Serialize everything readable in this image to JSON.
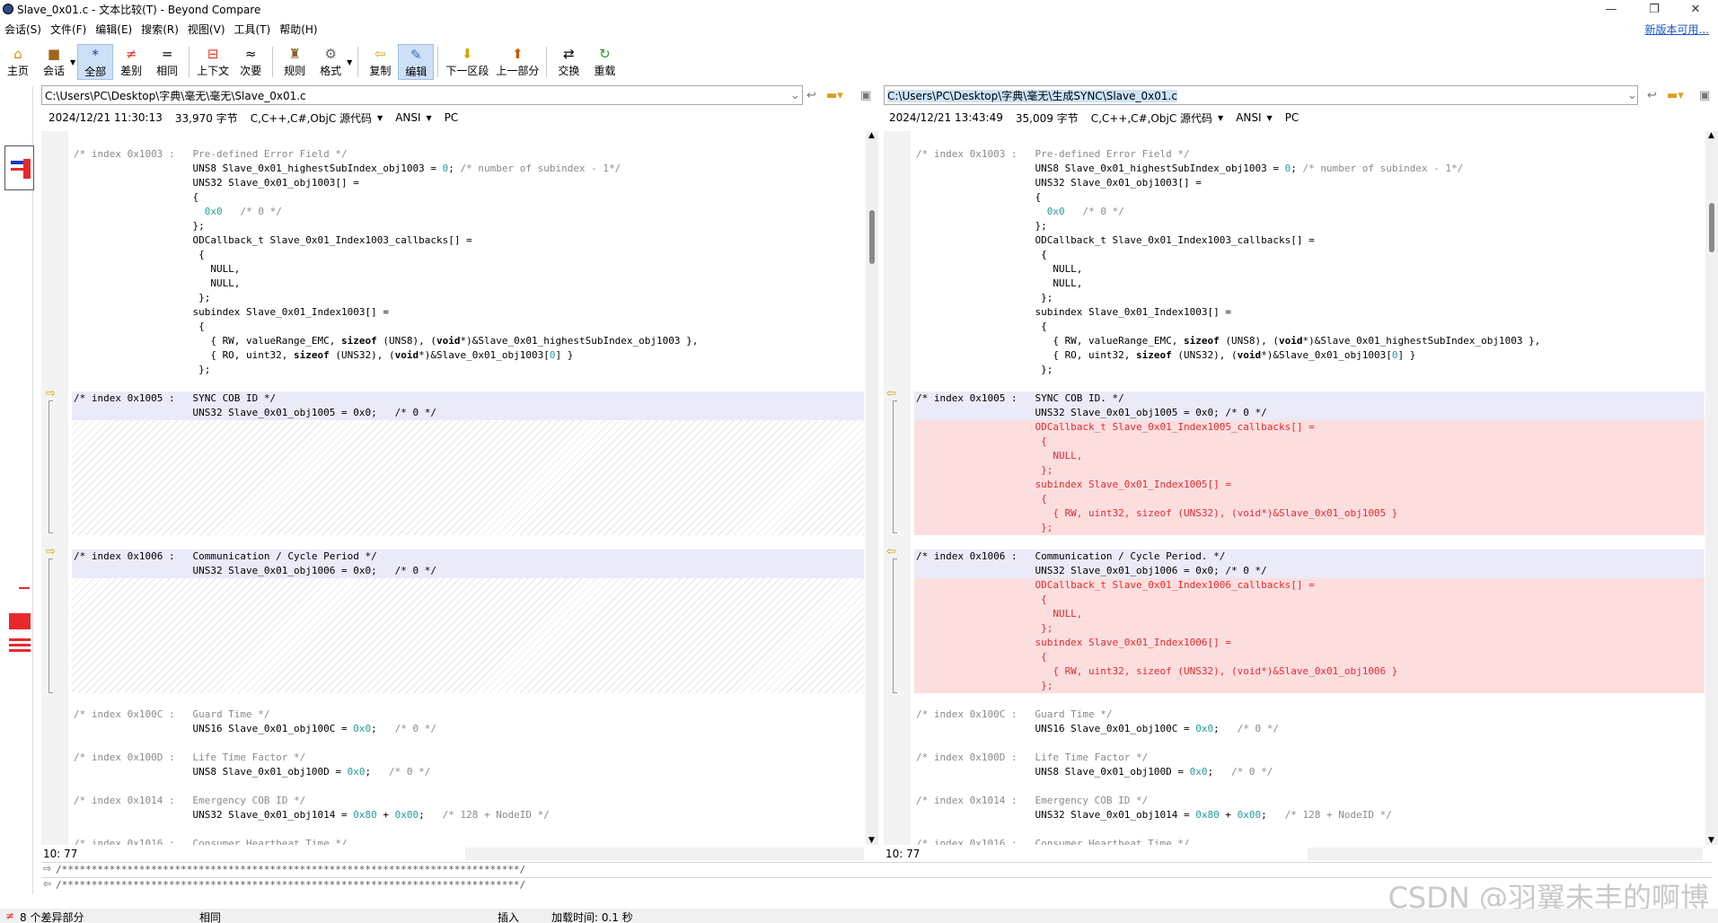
{
  "window": {
    "title": "Slave_0x01.c - 文本比较(T) - Beyond Compare",
    "controls": {
      "minimize": "—",
      "restore": "❐",
      "close": "✕"
    }
  },
  "menu": {
    "items": [
      "会话(S)",
      "文件(F)",
      "编辑(E)",
      "搜索(R)",
      "视图(V)",
      "工具(T)",
      "帮助(H)"
    ],
    "update_link": "新版本可用..."
  },
  "toolbar": {
    "home": "主页",
    "session": "会话",
    "all": "全部",
    "diffs": "差别",
    "same": "相同",
    "context": "上下文",
    "minor": "次要",
    "rules": "规则",
    "format": "格式",
    "copy": "复制",
    "edit": "编辑",
    "next_section": "下一区段",
    "prev_section": "上一部分",
    "swap": "交换",
    "reload": "重载"
  },
  "left": {
    "path": "C:\\Users\\PC\\Desktop\\字典\\毫无\\毫无\\Slave_0x01.c",
    "date": "2024/12/21 11:30:13",
    "size": "33,970 字节",
    "format": "C,C++,C#,ObjC 源代码",
    "encoding": "ANSI",
    "line_ending": "PC",
    "position": "10: 77"
  },
  "right": {
    "path": "C:\\Users\\PC\\Desktop\\字典\\毫无\\生成SYNC\\Slave_0x01.c",
    "date": "2024/12/21 13:43:49",
    "size": "35,009 字节",
    "format": "C,C++,C#,ObjC 源代码",
    "encoding": "ANSI",
    "line_ending": "PC",
    "position": "10: 77"
  },
  "code_left": [
    {
      "segs": [
        [
          "c",
          "/* index 0x1003 :   Pre-defined Error Field */"
        ]
      ]
    },
    {
      "segs": [
        [
          "t",
          "                    UNS8 Slave_0x01_highestSubIndex_obj1003 = "
        ],
        [
          "n",
          "0"
        ],
        [
          "t",
          "; "
        ],
        [
          "c",
          "/* number of subindex - 1*/"
        ]
      ]
    },
    {
      "segs": [
        [
          "t",
          "                    UNS32 Slave_0x01_obj1003[] ="
        ]
      ]
    },
    {
      "segs": [
        [
          "t",
          "                    {"
        ]
      ]
    },
    {
      "segs": [
        [
          "t",
          "                      "
        ],
        [
          "n",
          "0x0"
        ],
        [
          "t",
          "   "
        ],
        [
          "c",
          "/* 0 */"
        ]
      ]
    },
    {
      "segs": [
        [
          "t",
          "                    };"
        ]
      ]
    },
    {
      "segs": [
        [
          "t",
          "                    ODCallback_t Slave_0x01_Index1003_callbacks[] ="
        ]
      ]
    },
    {
      "segs": [
        [
          "t",
          "                     {"
        ]
      ]
    },
    {
      "segs": [
        [
          "t",
          "                       NULL,"
        ]
      ]
    },
    {
      "segs": [
        [
          "t",
          "                       NULL,"
        ]
      ]
    },
    {
      "segs": [
        [
          "t",
          "                     };"
        ]
      ]
    },
    {
      "segs": [
        [
          "t",
          "                    subindex Slave_0x01_Index1003[] ="
        ]
      ]
    },
    {
      "segs": [
        [
          "t",
          "                     {"
        ]
      ]
    },
    {
      "segs": [
        [
          "t",
          "                       { RW, valueRange_EMC, "
        ],
        [
          "k",
          "sizeof"
        ],
        [
          "t",
          " (UNS8), ("
        ],
        [
          "k",
          "void"
        ],
        [
          "t",
          "*)&Slave_0x01_highestSubIndex_obj1003 },"
        ]
      ]
    },
    {
      "segs": [
        [
          "t",
          "                       { RO, uint32, "
        ],
        [
          "k",
          "sizeof"
        ],
        [
          "t",
          " (UNS32), ("
        ],
        [
          "k",
          "void"
        ],
        [
          "t",
          "*)&Slave_0x01_obj1003["
        ],
        [
          "n",
          "0"
        ],
        [
          "t",
          "] }"
        ]
      ]
    },
    {
      "segs": [
        [
          "t",
          "                     };"
        ]
      ]
    },
    {
      "segs": [
        [
          "t",
          ""
        ]
      ]
    },
    {
      "segs": [
        [
          "t",
          "/* index 0x1005 :   SYNC COB ID */"
        ]
      ]
    },
    {
      "segs": [
        [
          "t",
          "                    UNS32 Slave_0x01_obj1005 = 0x0;   /* 0 */"
        ]
      ]
    },
    {
      "segs": [
        [
          "t",
          ""
        ]
      ]
    },
    {
      "segs": [
        [
          "t",
          ""
        ]
      ]
    },
    {
      "segs": [
        [
          "t",
          ""
        ]
      ]
    },
    {
      "segs": [
        [
          "t",
          ""
        ]
      ]
    },
    {
      "segs": [
        [
          "t",
          ""
        ]
      ]
    },
    {
      "segs": [
        [
          "t",
          ""
        ]
      ]
    },
    {
      "segs": [
        [
          "t",
          ""
        ]
      ]
    },
    {
      "segs": [
        [
          "t",
          ""
        ]
      ]
    },
    {
      "segs": [
        [
          "t",
          ""
        ]
      ]
    },
    {
      "segs": [
        [
          "t",
          "/* index 0x1006 :   Communication / Cycle Period */"
        ]
      ]
    },
    {
      "segs": [
        [
          "t",
          "                    UNS32 Slave_0x01_obj1006 = 0x0;   /* 0 */"
        ]
      ]
    },
    {
      "segs": [
        [
          "t",
          ""
        ]
      ]
    },
    {
      "segs": [
        [
          "t",
          ""
        ]
      ]
    },
    {
      "segs": [
        [
          "t",
          ""
        ]
      ]
    },
    {
      "segs": [
        [
          "t",
          ""
        ]
      ]
    },
    {
      "segs": [
        [
          "t",
          ""
        ]
      ]
    },
    {
      "segs": [
        [
          "t",
          ""
        ]
      ]
    },
    {
      "segs": [
        [
          "t",
          ""
        ]
      ]
    },
    {
      "segs": [
        [
          "t",
          ""
        ]
      ]
    },
    {
      "segs": [
        [
          "t",
          ""
        ]
      ]
    },
    {
      "segs": [
        [
          "c",
          "/* index 0x100C :   Guard Time */"
        ]
      ]
    },
    {
      "segs": [
        [
          "t",
          "                    UNS16 Slave_0x01_obj100C = "
        ],
        [
          "n",
          "0x0"
        ],
        [
          "t",
          ";   "
        ],
        [
          "c",
          "/* 0 */"
        ]
      ]
    },
    {
      "segs": [
        [
          "t",
          ""
        ]
      ]
    },
    {
      "segs": [
        [
          "c",
          "/* index 0x100D :   Life Time Factor */"
        ]
      ]
    },
    {
      "segs": [
        [
          "t",
          "                    UNS8 Slave_0x01_obj100D = "
        ],
        [
          "n",
          "0x0"
        ],
        [
          "t",
          ";   "
        ],
        [
          "c",
          "/* 0 */"
        ]
      ]
    },
    {
      "segs": [
        [
          "t",
          ""
        ]
      ]
    },
    {
      "segs": [
        [
          "c",
          "/* index 0x1014 :   Emergency COB ID */"
        ]
      ]
    },
    {
      "segs": [
        [
          "t",
          "                    UNS32 Slave_0x01_obj1014 = "
        ],
        [
          "n",
          "0x80"
        ],
        [
          "t",
          " + "
        ],
        [
          "n",
          "0x00"
        ],
        [
          "t",
          ";   "
        ],
        [
          "c",
          "/* 128 + NodeID */"
        ]
      ]
    },
    {
      "segs": [
        [
          "t",
          ""
        ]
      ]
    },
    {
      "segs": [
        [
          "c",
          "/* index 0x1016 :   Consumer Heartbeat Time */"
        ]
      ]
    }
  ],
  "code_right": [
    {
      "segs": [
        [
          "c",
          "/* index 0x1003 :   Pre-defined Error Field */"
        ]
      ]
    },
    {
      "segs": [
        [
          "t",
          "                    UNS8 Slave_0x01_highestSubIndex_obj1003 = "
        ],
        [
          "n",
          "0"
        ],
        [
          "t",
          "; "
        ],
        [
          "c",
          "/* number of subindex - 1*/"
        ]
      ]
    },
    {
      "segs": [
        [
          "t",
          "                    UNS32 Slave_0x01_obj1003[] ="
        ]
      ]
    },
    {
      "segs": [
        [
          "t",
          "                    {"
        ]
      ]
    },
    {
      "segs": [
        [
          "t",
          "                      "
        ],
        [
          "n",
          "0x0"
        ],
        [
          "t",
          "   "
        ],
        [
          "c",
          "/* 0 */"
        ]
      ]
    },
    {
      "segs": [
        [
          "t",
          "                    };"
        ]
      ]
    },
    {
      "segs": [
        [
          "t",
          "                    ODCallback_t Slave_0x01_Index1003_callbacks[] ="
        ]
      ]
    },
    {
      "segs": [
        [
          "t",
          "                     {"
        ]
      ]
    },
    {
      "segs": [
        [
          "t",
          "                       NULL,"
        ]
      ]
    },
    {
      "segs": [
        [
          "t",
          "                       NULL,"
        ]
      ]
    },
    {
      "segs": [
        [
          "t",
          "                     };"
        ]
      ]
    },
    {
      "segs": [
        [
          "t",
          "                    subindex Slave_0x01_Index1003[] ="
        ]
      ]
    },
    {
      "segs": [
        [
          "t",
          "                     {"
        ]
      ]
    },
    {
      "segs": [
        [
          "t",
          "                       { RW, valueRange_EMC, "
        ],
        [
          "k",
          "sizeof"
        ],
        [
          "t",
          " (UNS8), ("
        ],
        [
          "k",
          "void"
        ],
        [
          "t",
          "*)&Slave_0x01_highestSubIndex_obj1003 },"
        ]
      ]
    },
    {
      "segs": [
        [
          "t",
          "                       { RO, uint32, "
        ],
        [
          "k",
          "sizeof"
        ],
        [
          "t",
          " (UNS32), ("
        ],
        [
          "k",
          "void"
        ],
        [
          "t",
          "*)&Slave_0x01_obj1003["
        ],
        [
          "n",
          "0"
        ],
        [
          "t",
          "] }"
        ]
      ]
    },
    {
      "segs": [
        [
          "t",
          "                     };"
        ]
      ]
    },
    {
      "segs": [
        [
          "t",
          ""
        ]
      ]
    },
    {
      "segs": [
        [
          "t",
          "/* index 0x1005 :   SYNC COB ID. */"
        ]
      ]
    },
    {
      "segs": [
        [
          "t",
          "                    UNS32 Slave_0x01_obj1005 = 0x0; /* 0 */"
        ]
      ]
    },
    {
      "segs": [
        [
          "r",
          "                    ODCallback_t Slave_0x01_Index1005_callbacks[] ="
        ]
      ]
    },
    {
      "segs": [
        [
          "r",
          "                     {"
        ]
      ]
    },
    {
      "segs": [
        [
          "r",
          "                       NULL,"
        ]
      ]
    },
    {
      "segs": [
        [
          "r",
          "                     };"
        ]
      ]
    },
    {
      "segs": [
        [
          "r",
          "                    subindex Slave_0x01_Index1005[] ="
        ]
      ]
    },
    {
      "segs": [
        [
          "r",
          "                     {"
        ]
      ]
    },
    {
      "segs": [
        [
          "r",
          "                       { RW, uint32, sizeof (UNS32), (void*)&Slave_0x01_obj1005 }"
        ]
      ]
    },
    {
      "segs": [
        [
          "r",
          "                     };"
        ]
      ]
    },
    {
      "segs": [
        [
          "t",
          ""
        ]
      ]
    },
    {
      "segs": [
        [
          "t",
          "/* index 0x1006 :   Communication / Cycle Period. */"
        ]
      ]
    },
    {
      "segs": [
        [
          "t",
          "                    UNS32 Slave_0x01_obj1006 = 0x0; /* 0 */"
        ]
      ]
    },
    {
      "segs": [
        [
          "r",
          "                    ODCallback_t Slave_0x01_Index1006_callbacks[] ="
        ]
      ]
    },
    {
      "segs": [
        [
          "r",
          "                     {"
        ]
      ]
    },
    {
      "segs": [
        [
          "r",
          "                       NULL,"
        ]
      ]
    },
    {
      "segs": [
        [
          "r",
          "                     };"
        ]
      ]
    },
    {
      "segs": [
        [
          "r",
          "                    subindex Slave_0x01_Index1006[] ="
        ]
      ]
    },
    {
      "segs": [
        [
          "r",
          "                     {"
        ]
      ]
    },
    {
      "segs": [
        [
          "r",
          "                       { RW, uint32, sizeof (UNS32), (void*)&Slave_0x01_obj1006 }"
        ]
      ]
    },
    {
      "segs": [
        [
          "r",
          "                     };"
        ]
      ]
    },
    {
      "segs": [
        [
          "t",
          ""
        ]
      ]
    },
    {
      "segs": [
        [
          "c",
          "/* index 0x100C :   Guard Time */"
        ]
      ]
    },
    {
      "segs": [
        [
          "t",
          "                    UNS16 Slave_0x01_obj100C = "
        ],
        [
          "n",
          "0x0"
        ],
        [
          "t",
          ";   "
        ],
        [
          "c",
          "/* 0 */"
        ]
      ]
    },
    {
      "segs": [
        [
          "t",
          ""
        ]
      ]
    },
    {
      "segs": [
        [
          "c",
          "/* index 0x100D :   Life Time Factor */"
        ]
      ]
    },
    {
      "segs": [
        [
          "t",
          "                    UNS8 Slave_0x01_obj100D = "
        ],
        [
          "n",
          "0x0"
        ],
        [
          "t",
          ";   "
        ],
        [
          "c",
          "/* 0 */"
        ]
      ]
    },
    {
      "segs": [
        [
          "t",
          ""
        ]
      ]
    },
    {
      "segs": [
        [
          "c",
          "/* index 0x1014 :   Emergency COB ID */"
        ]
      ]
    },
    {
      "segs": [
        [
          "t",
          "                    UNS32 Slave_0x01_obj1014 = "
        ],
        [
          "n",
          "0x80"
        ],
        [
          "t",
          " + "
        ],
        [
          "n",
          "0x00"
        ],
        [
          "t",
          ";   "
        ],
        [
          "c",
          "/* 128 + NodeID */"
        ]
      ]
    },
    {
      "segs": [
        [
          "t",
          ""
        ]
      ]
    },
    {
      "segs": [
        [
          "c",
          "/* index 0x1016 :   Consumer Heartbeat Time */"
        ]
      ]
    }
  ],
  "bottom_lines": {
    "line1": "/*****************************************************************************/",
    "line2": "/*****************************************************************************/"
  },
  "status": {
    "diff_count": "8 个差异部分",
    "state": "相同",
    "mode": "插入",
    "load_time": "加载时间: 0.1 秒"
  },
  "watermark": "CSDN @羽翼未丰的啊博",
  "icons": {
    "home": "home-icon",
    "session": "briefcase-icon",
    "all": "asterisk-icon",
    "diffs": "not-equal-icon",
    "same": "equal-icon",
    "context": "context-icon",
    "minor": "approx-icon",
    "rules": "referee-icon",
    "format": "format-icon",
    "copy": "copy-arrow-icon",
    "edit": "edit-icon",
    "next": "down-arrow-icon",
    "prev": "up-arrow-icon",
    "swap": "swap-icon",
    "reload": "reload-icon"
  },
  "colors": {
    "diff_red": "#e8292c",
    "diff_bg": "#fcdede",
    "section_bg": "#eaeaf8",
    "accent": "#1a56c8",
    "number": "#2a9a9a",
    "comment": "#8a8a8a"
  }
}
